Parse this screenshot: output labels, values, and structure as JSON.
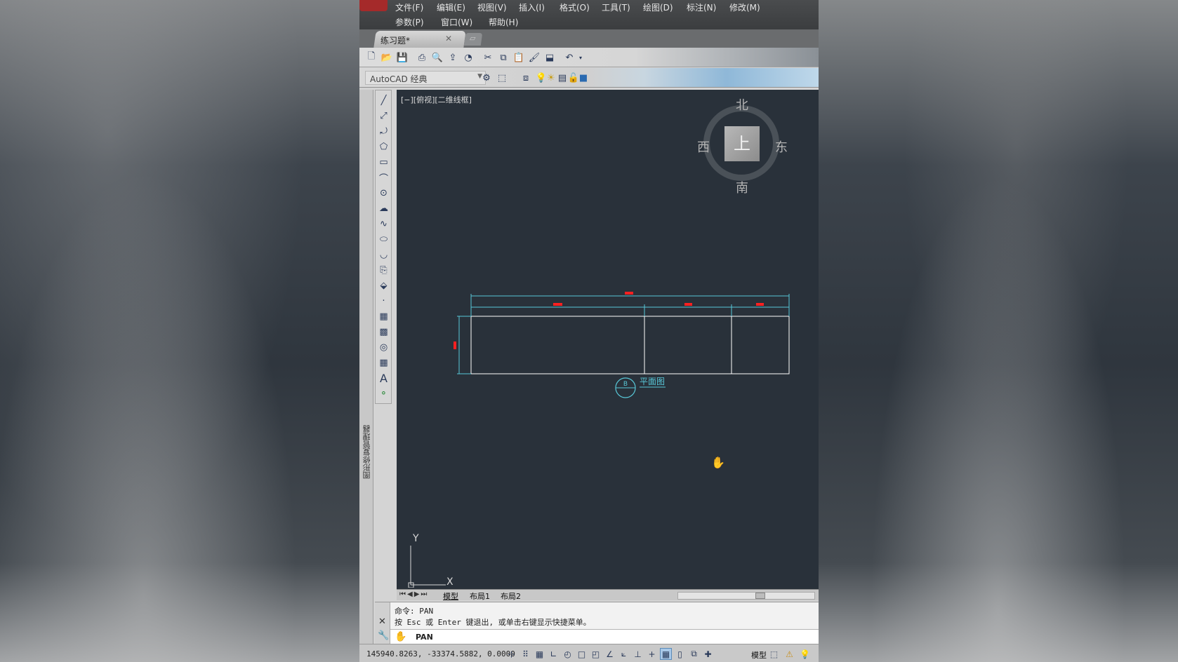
{
  "menu": {
    "row1": [
      "文件(F)",
      "编辑(E)",
      "视图(V)",
      "插入(I)",
      "格式(O)",
      "工具(T)",
      "绘图(D)",
      "标注(N)",
      "修改(M)"
    ],
    "row2": [
      "参数(P)",
      "窗口(W)",
      "帮助(H)"
    ]
  },
  "tabs": {
    "document": "练习题*",
    "close": "✕"
  },
  "toolbar": {
    "workspace": "AutoCAD 经典"
  },
  "left_palette": {
    "label": "图形修复管理器"
  },
  "canvas": {
    "view_label": "[−][俯视][二维线框]",
    "viewcube": {
      "face": "上",
      "north": "北",
      "south": "南",
      "east": "东",
      "west": "西"
    },
    "drawing": {
      "view_title": "平面图",
      "marker_letter": "B",
      "dimension_color": "#ff2020",
      "line_color": "#ffffff",
      "dim_line_color": "#58c8d8"
    },
    "ucs": {
      "x": "X",
      "y": "Y"
    }
  },
  "layout_tabs": [
    "模型",
    "布局1",
    "布局2"
  ],
  "command": {
    "history1": "命令:  PAN",
    "history2": "按 Esc 或 Enter 键退出, 或单击右键显示快捷菜单。",
    "current": "PAN"
  },
  "status": {
    "coordinates": "145940.8263,  -33374.5882,  0.0000",
    "model": "模型"
  },
  "colors": {
    "canvas_bg": "#29313a",
    "accent": "#a52a2a"
  }
}
